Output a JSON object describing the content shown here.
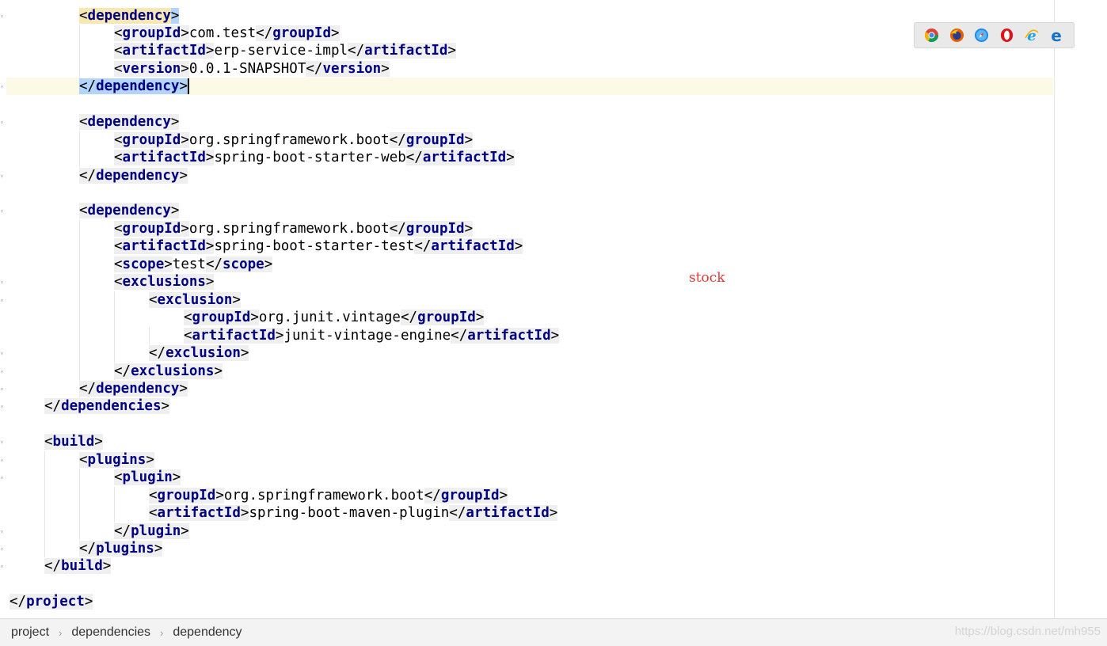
{
  "editor": {
    "lines": [
      {
        "indent": 2,
        "parts": [
          {
            "k": "tag",
            "v": "dependency",
            "open": true
          }
        ],
        "note": "l1"
      },
      {
        "indent": 3,
        "parts": [
          {
            "k": "tag",
            "v": "groupId",
            "open": true
          },
          {
            "k": "text",
            "v": "com.test"
          },
          {
            "k": "tag",
            "v": "groupId",
            "open": false
          }
        ]
      },
      {
        "indent": 3,
        "parts": [
          {
            "k": "tag",
            "v": "artifactId",
            "open": true
          },
          {
            "k": "text",
            "v": "erp-service-impl"
          },
          {
            "k": "tag",
            "v": "artifactId",
            "open": false
          }
        ]
      },
      {
        "indent": 3,
        "parts": [
          {
            "k": "tag",
            "v": "version",
            "open": true
          },
          {
            "k": "text",
            "v": "0.0.1-SNAPSHOT"
          },
          {
            "k": "tag",
            "v": "version",
            "open": false
          }
        ]
      },
      {
        "indent": 2,
        "parts": [
          {
            "k": "tag",
            "v": "dependency",
            "open": false
          }
        ],
        "current": true
      },
      {
        "indent": 0,
        "parts": []
      },
      {
        "indent": 2,
        "parts": [
          {
            "k": "tag",
            "v": "dependency",
            "open": true
          }
        ]
      },
      {
        "indent": 3,
        "parts": [
          {
            "k": "tag",
            "v": "groupId",
            "open": true
          },
          {
            "k": "text",
            "v": "org.springframework.boot"
          },
          {
            "k": "tag",
            "v": "groupId",
            "open": false
          }
        ]
      },
      {
        "indent": 3,
        "parts": [
          {
            "k": "tag",
            "v": "artifactId",
            "open": true
          },
          {
            "k": "text",
            "v": "spring-boot-starter-web"
          },
          {
            "k": "tag",
            "v": "artifactId",
            "open": false
          }
        ]
      },
      {
        "indent": 2,
        "parts": [
          {
            "k": "tag",
            "v": "dependency",
            "open": false
          }
        ]
      },
      {
        "indent": 0,
        "parts": []
      },
      {
        "indent": 2,
        "parts": [
          {
            "k": "tag",
            "v": "dependency",
            "open": true
          }
        ]
      },
      {
        "indent": 3,
        "parts": [
          {
            "k": "tag",
            "v": "groupId",
            "open": true
          },
          {
            "k": "text",
            "v": "org.springframework.boot"
          },
          {
            "k": "tag",
            "v": "groupId",
            "open": false
          }
        ]
      },
      {
        "indent": 3,
        "parts": [
          {
            "k": "tag",
            "v": "artifactId",
            "open": true
          },
          {
            "k": "text",
            "v": "spring-boot-starter-test"
          },
          {
            "k": "tag",
            "v": "artifactId",
            "open": false
          }
        ]
      },
      {
        "indent": 3,
        "parts": [
          {
            "k": "tag",
            "v": "scope",
            "open": true
          },
          {
            "k": "text",
            "v": "test"
          },
          {
            "k": "tag",
            "v": "scope",
            "open": false
          }
        ]
      },
      {
        "indent": 3,
        "parts": [
          {
            "k": "tag",
            "v": "exclusions",
            "open": true
          }
        ]
      },
      {
        "indent": 4,
        "parts": [
          {
            "k": "tag",
            "v": "exclusion",
            "open": true
          }
        ]
      },
      {
        "indent": 5,
        "parts": [
          {
            "k": "tag",
            "v": "groupId",
            "open": true
          },
          {
            "k": "text",
            "v": "org.junit.vintage"
          },
          {
            "k": "tag",
            "v": "groupId",
            "open": false
          }
        ]
      },
      {
        "indent": 5,
        "parts": [
          {
            "k": "tag",
            "v": "artifactId",
            "open": true
          },
          {
            "k": "text",
            "v": "junit-vintage-engine"
          },
          {
            "k": "tag",
            "v": "artifactId",
            "open": false
          }
        ]
      },
      {
        "indent": 4,
        "parts": [
          {
            "k": "tag",
            "v": "exclusion",
            "open": false
          }
        ]
      },
      {
        "indent": 3,
        "parts": [
          {
            "k": "tag",
            "v": "exclusions",
            "open": false
          }
        ]
      },
      {
        "indent": 2,
        "parts": [
          {
            "k": "tag",
            "v": "dependency",
            "open": false
          }
        ]
      },
      {
        "indent": 1,
        "parts": [
          {
            "k": "tag",
            "v": "dependencies",
            "open": false
          }
        ]
      },
      {
        "indent": 0,
        "parts": []
      },
      {
        "indent": 1,
        "parts": [
          {
            "k": "tag",
            "v": "build",
            "open": true
          }
        ]
      },
      {
        "indent": 2,
        "parts": [
          {
            "k": "tag",
            "v": "plugins",
            "open": true
          }
        ]
      },
      {
        "indent": 3,
        "parts": [
          {
            "k": "tag",
            "v": "plugin",
            "open": true
          }
        ]
      },
      {
        "indent": 4,
        "parts": [
          {
            "k": "tag",
            "v": "groupId",
            "open": true
          },
          {
            "k": "text",
            "v": "org.springframework.boot"
          },
          {
            "k": "tag",
            "v": "groupId",
            "open": false
          }
        ]
      },
      {
        "indent": 4,
        "parts": [
          {
            "k": "tag",
            "v": "artifactId",
            "open": true
          },
          {
            "k": "text",
            "v": "spring-boot-maven-plugin"
          },
          {
            "k": "tag",
            "v": "artifactId",
            "open": false
          }
        ]
      },
      {
        "indent": 3,
        "parts": [
          {
            "k": "tag",
            "v": "plugin",
            "open": false
          }
        ]
      },
      {
        "indent": 2,
        "parts": [
          {
            "k": "tag",
            "v": "plugins",
            "open": false
          }
        ]
      },
      {
        "indent": 1,
        "parts": [
          {
            "k": "tag",
            "v": "build",
            "open": false
          }
        ]
      },
      {
        "indent": 0,
        "parts": []
      },
      {
        "indent": 0,
        "parts": [
          {
            "k": "tag",
            "v": "project",
            "open": false
          }
        ]
      }
    ]
  },
  "browser_icons": [
    {
      "name": "chrome-icon",
      "color": "#db4437"
    },
    {
      "name": "firefox-icon",
      "color": "#e66000"
    },
    {
      "name": "safari-icon",
      "color": "#1e88e5"
    },
    {
      "name": "opera-icon",
      "color": "#e0131a"
    },
    {
      "name": "internet-explorer-icon",
      "color": "#1ea1e8"
    },
    {
      "name": "edge-icon",
      "color": "#1572c5"
    }
  ],
  "annotation": {
    "text": "stock",
    "color": "#e23a3a"
  },
  "breadcrumb": {
    "items": [
      "project",
      "dependencies",
      "dependency"
    ]
  },
  "watermark": {
    "text": "https://blog.csdn.net/mh955"
  }
}
